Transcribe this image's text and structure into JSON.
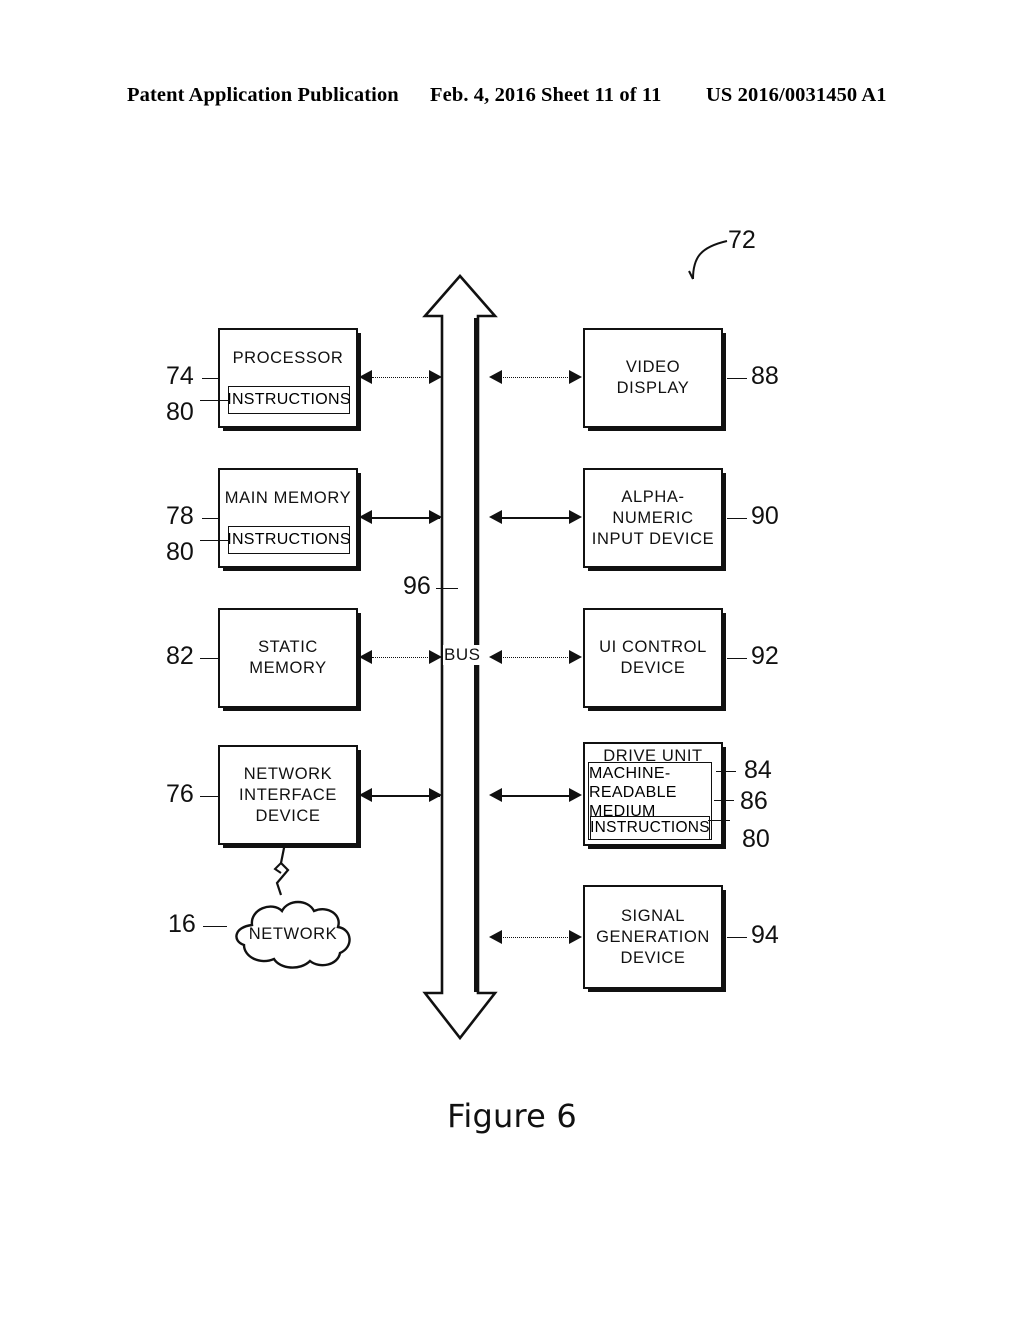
{
  "header": {
    "title": "Patent Application Publication",
    "date": "Feb. 4, 2016",
    "sheet": "Sheet 11 of 11",
    "patent_number": "US 2016/0031450 A1"
  },
  "caption": "Figure 6",
  "system_ref": "72",
  "bus": {
    "label": "BUS",
    "ref": "96"
  },
  "left_column": [
    {
      "name": "processor",
      "label": "PROCESSOR",
      "ref": "74",
      "sub": {
        "label": "INSTRUCTIONS",
        "ref": "80"
      }
    },
    {
      "name": "main-memory",
      "label": "MAIN MEMORY",
      "ref": "78",
      "sub": {
        "label": "INSTRUCTIONS",
        "ref": "80"
      }
    },
    {
      "name": "static-memory",
      "label": "STATIC\nMEMORY",
      "ref": "82"
    },
    {
      "name": "network-interface-device",
      "label": "NETWORK\nINTERFACE\nDEVICE",
      "ref": "76"
    }
  ],
  "right_column": [
    {
      "name": "video-display",
      "label": "VIDEO\nDISPLAY",
      "ref": "88"
    },
    {
      "name": "alpha-numeric-input-device",
      "label": "ALPHA-NUMERIC\nINPUT DEVICE",
      "ref": "90"
    },
    {
      "name": "ui-control-device",
      "label": "UI CONTROL\nDEVICE",
      "ref": "92"
    },
    {
      "name": "drive-unit",
      "label": "DRIVE UNIT",
      "ref": "84",
      "medium": {
        "label": "MACHINE-\nREADABLE\nMEDIUM",
        "ref": "86"
      },
      "sub": {
        "label": "INSTRUCTIONS",
        "ref": "80"
      }
    },
    {
      "name": "signal-generation-device",
      "label": "SIGNAL\nGENERATION\nDEVICE",
      "ref": "94"
    }
  ],
  "network": {
    "label": "NETWORK",
    "ref": "16"
  }
}
